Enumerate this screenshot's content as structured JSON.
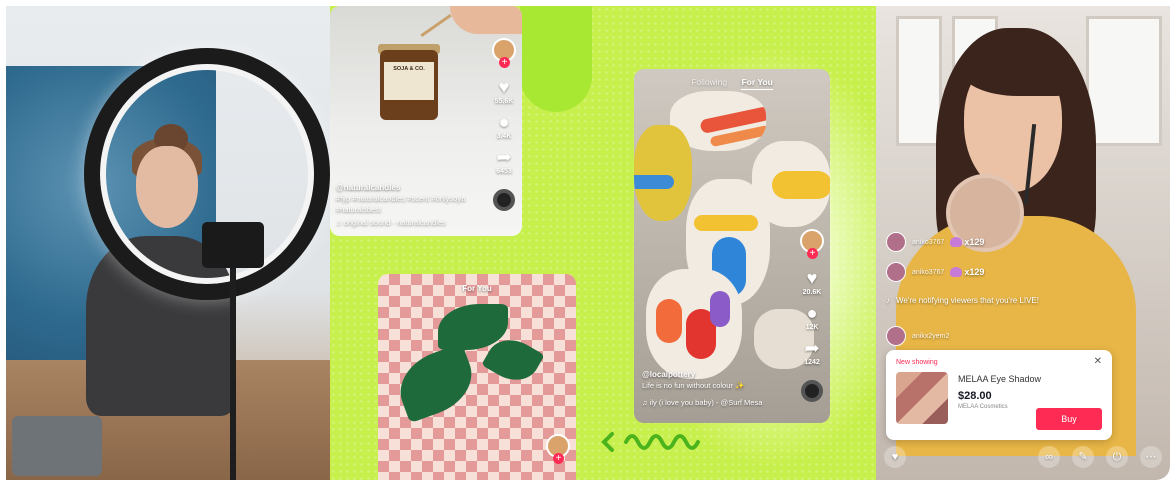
{
  "candle_post": {
    "likes": "55.6K",
    "comments": "3.4K",
    "shares": "6453",
    "username": "@naturalcandles",
    "hashtags": "#fyp #naturalcandles #scent #onlysoya #naturalsbest",
    "sound": "original sound - naturalcandles",
    "jar_label": "SOJA & CO."
  },
  "fabric_post": {
    "tab": "For You"
  },
  "pottery_post": {
    "tab_following": "Following",
    "tab_foryou": "For You",
    "likes": "20.6K",
    "comments": "12K",
    "shares": "1242",
    "username": "@localpottery",
    "caption": "Life is no fun without colour ✨",
    "sound": "ily (i love you baby) - @Surf Mesa"
  },
  "live": {
    "messages": [
      {
        "name": "aniko3767",
        "gift": "x129"
      },
      {
        "name": "aniko3767",
        "gift": "x129"
      },
      {
        "name": "",
        "gift": "We're notifying viewers that you're LIVE!"
      },
      {
        "name": "anikx2yem2",
        "gift": ""
      }
    ],
    "product": {
      "now_showing": "New showing",
      "name": "MELAA Eye Shadow",
      "price": "$28.00",
      "brand": "MELAA Cosmetics",
      "buy_label": "Buy"
    }
  },
  "icons": {
    "heart": "heart-icon",
    "comment": "comment-icon",
    "share": "share-icon",
    "music": "music-note-icon",
    "close": "close-icon"
  },
  "colors": {
    "tiktok_red": "#fe2c55",
    "lime": "#c8f04d"
  }
}
